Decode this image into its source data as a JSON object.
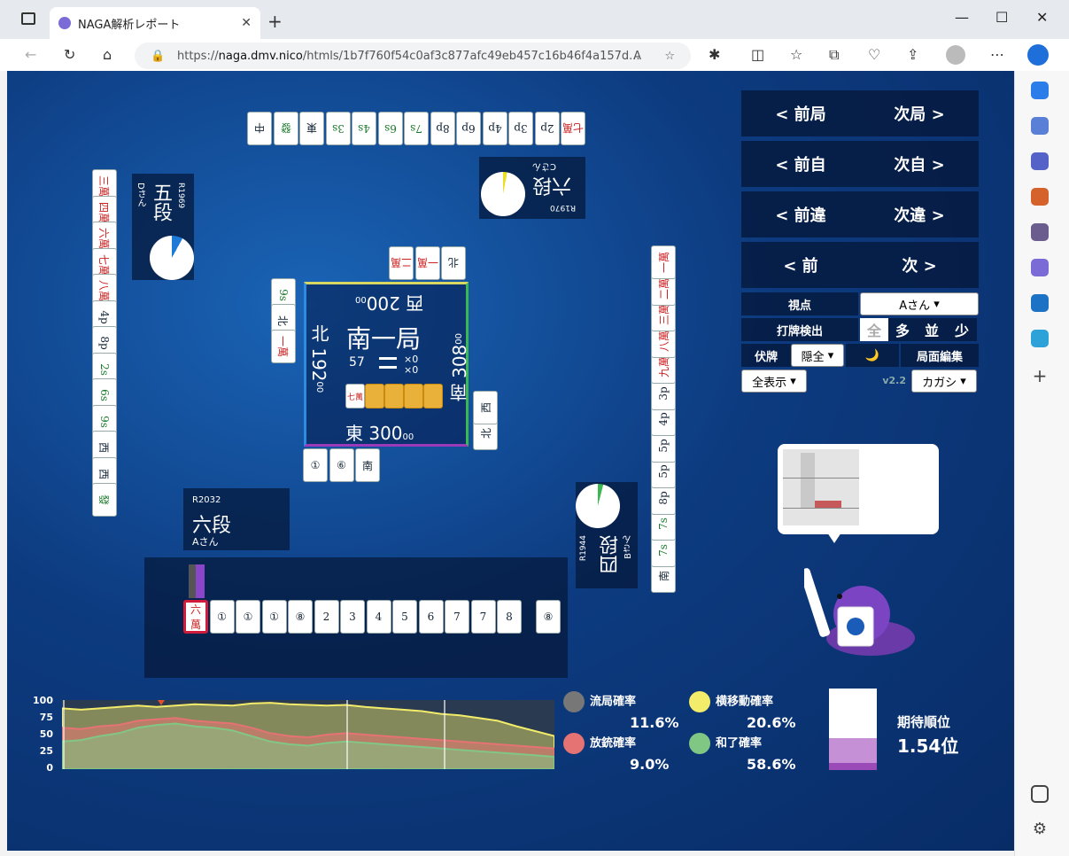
{
  "browser": {
    "tab_title": "NAGA解析レポート",
    "url_prefix": "https://",
    "url_host": "naga.dmv.nico",
    "url_path": "/htmls/1b7f760f54c0af3c877afc49eb457c16b46f4a157d..."
  },
  "nav": {
    "prev_round": "< 前局",
    "next_round": "次局 >",
    "prev_self": "< 前自",
    "next_self": "次自 >",
    "prev_diff": "< 前違",
    "next_diff": "次違 >",
    "prev": "< 前",
    "next": "次 >"
  },
  "controls": {
    "viewpoint_label": "視点",
    "viewpoint_value": "Aさん",
    "detect_label": "打牌検出",
    "detect_opts": [
      "全",
      "多",
      "並",
      "少"
    ],
    "fuku_label": "伏牌",
    "fuku_value": "隠全",
    "moon": "🌙",
    "edit": "局面編集",
    "display_value": "全表示",
    "version": "v2.2",
    "model_value": "カガシ"
  },
  "center": {
    "round": "南一局",
    "tiles_left": "57",
    "honba": "×0",
    "riichi": "×0",
    "north": "北 192",
    "north_sub": "00",
    "west": "西 200",
    "west_sub": "00",
    "south": "南 308",
    "south_sub": "00",
    "east": "東 300",
    "east_sub": "00",
    "dora": "七萬"
  },
  "players": {
    "self": {
      "rating": "R2032",
      "rank": "六段",
      "name": "Aさん"
    },
    "right": {
      "rating": "R1944",
      "rank": "四段",
      "name": "Bさん"
    },
    "top": {
      "rating": "R1970",
      "rank": "六段",
      "name": "Cさん"
    },
    "left": {
      "rating": "R1969",
      "rank": "五段",
      "name": "Dさん"
    }
  },
  "hand": [
    "六萬",
    "①",
    "①",
    "①",
    "⑧",
    "2",
    "3",
    "4",
    "5",
    "6",
    "7",
    "7",
    "8",
    "⑧"
  ],
  "hand_labels": [
    "六\n萬",
    "●",
    "●",
    "●",
    "⠿",
    "II",
    "II",
    "III",
    "III",
    "III",
    "III",
    "III",
    "III"
  ],
  "draw_tile": "⑧",
  "top_river": [
    "中",
    "發",
    "東",
    "3s",
    "4s",
    "6s",
    "7s",
    "8p",
    "6p",
    "4p",
    "3p",
    "2p",
    "七萬"
  ],
  "left_river": [
    "三萬",
    "四萬",
    "六萬",
    "七萬",
    "八萬",
    "4p",
    "8p",
    "2s",
    "6s",
    "9s",
    "西",
    "西",
    "發"
  ],
  "right_river": [
    "南",
    "7s",
    "7s",
    "8p",
    "5p",
    "5p",
    "4p",
    "3p",
    "九萬",
    "八萬",
    "三萬",
    "二萬",
    "一萬"
  ],
  "self_river": [
    "①",
    "⑥",
    "南"
  ],
  "top_small": [
    "北",
    "一萬",
    "二萬"
  ],
  "left_small": [
    "9s",
    "北",
    "一萬"
  ],
  "right_small": [
    "北",
    "西"
  ],
  "stats": {
    "ryukyoku_label": "流局確率",
    "ryukyoku_value": "11.6%",
    "yoko_label": "横移動確率",
    "yoko_value": "20.6%",
    "hoju_label": "放銃確率",
    "hoju_value": "9.0%",
    "hora_label": "和了確率",
    "hora_value": "58.6%",
    "expected_label": "期待順位",
    "expected_value": "1.54位",
    "colors": {
      "ryukyoku": "#777777",
      "yoko": "#f2ec6a",
      "hoju": "#e57373",
      "hora": "#81c784"
    }
  },
  "chart_data": {
    "type": "area",
    "yticks": [
      "100",
      "75",
      "50",
      "25",
      "0"
    ],
    "ylim": [
      0,
      100
    ],
    "series": [
      {
        "name": "横移動確率",
        "values": [
          88,
          86,
          88,
          90,
          92,
          90,
          92,
          94,
          93,
          92,
          95,
          96,
          94,
          93,
          92,
          93,
          90,
          88,
          86,
          84,
          80,
          78,
          74,
          70,
          62,
          55,
          48
        ]
      },
      {
        "name": "放銃確率",
        "values": [
          60,
          58,
          62,
          64,
          70,
          72,
          74,
          70,
          68,
          66,
          60,
          52,
          48,
          46,
          50,
          52,
          50,
          48,
          46,
          44,
          42,
          40,
          38,
          36,
          34,
          32,
          30
        ]
      },
      {
        "name": "和了確率",
        "values": [
          40,
          42,
          48,
          52,
          60,
          64,
          66,
          62,
          60,
          56,
          48,
          40,
          36,
          34,
          38,
          40,
          38,
          36,
          34,
          32,
          30,
          28,
          26,
          24,
          22,
          20,
          18
        ]
      }
    ]
  }
}
